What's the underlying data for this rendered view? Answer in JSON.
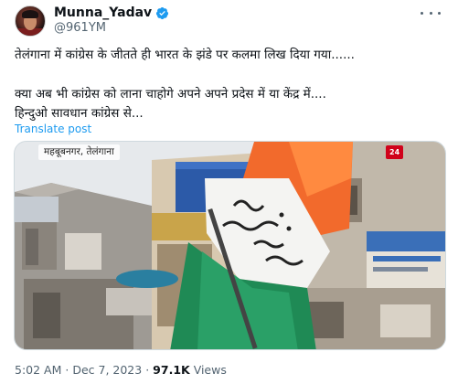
{
  "user": {
    "display_name": "Munna_Yadav",
    "handle": "@961YM",
    "verified_color": "#1d9bf0"
  },
  "tweet": {
    "line1": "तेलंगाना में कांग्रेस के जीतते ही भारत के झंडे पर कलमा लिख दिया गया......",
    "line2": "क्या अब भी कांग्रेस को लाना चाहोगे अपने अपने प्रदेस में या केंद्र में....",
    "line3": "हिन्दुओ सावधान कांग्रेस से...",
    "translate_label": "Translate post"
  },
  "media": {
    "caption": "महबूबनगर, तेलंगाना"
  },
  "meta": {
    "time": "5:02 AM",
    "date": "Dec 7, 2023",
    "separator": "·",
    "views_count": "97.1K",
    "views_label": "Views"
  },
  "icons": {
    "verified": "verified-badge-icon",
    "more": "more-dots-icon"
  }
}
